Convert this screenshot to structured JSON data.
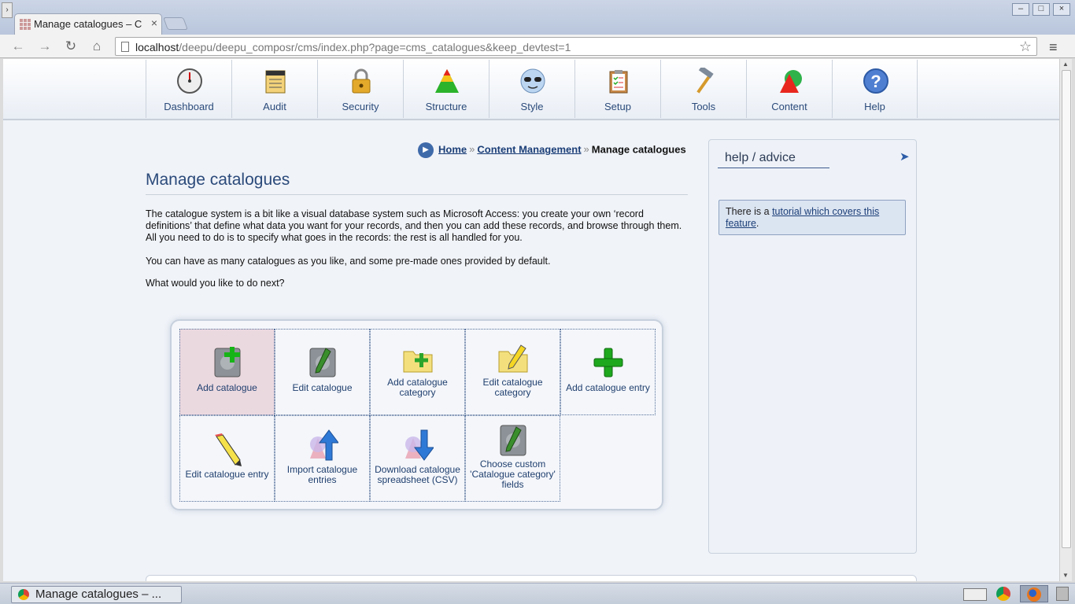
{
  "browser": {
    "tab_title": "Manage catalogues – C",
    "url_host": "localhost",
    "url_path": "/deepu/deepu_composr/cms/index.php?page=cms_catalogues&keep_devtest=1"
  },
  "admin_menu": [
    {
      "label": "Dashboard",
      "icon": "dashboard-gauge-icon"
    },
    {
      "label": "Audit",
      "icon": "audit-ledger-icon"
    },
    {
      "label": "Security",
      "icon": "padlock-icon"
    },
    {
      "label": "Structure",
      "icon": "pyramid-icon"
    },
    {
      "label": "Style",
      "icon": "sunglasses-face-icon"
    },
    {
      "label": "Setup",
      "icon": "clipboard-checklist-icon"
    },
    {
      "label": "Tools",
      "icon": "hammer-icon"
    },
    {
      "label": "Content",
      "icon": "shapes-icon"
    },
    {
      "label": "Help",
      "icon": "question-mark-icon"
    }
  ],
  "breadcrumb": {
    "home": "Home",
    "sep": "»",
    "section": "Content Management",
    "current": "Manage catalogues"
  },
  "page": {
    "title": "Manage catalogues",
    "intro": "The catalogue system is a bit like a visual database system such as Microsoft Access: you create your own ‘record definitions’ that define what data you want for your records, and then you can add these records, and browse through them. All you need to do is to specify what goes in the records: the rest is all handled for you.",
    "intro2": "You can have as many catalogues as you like, and some pre-made ones provided by default.",
    "prompt": "What would you like to do next?"
  },
  "actions": [
    {
      "label": "Add catalogue",
      "icon": "add-catalogue-icon"
    },
    {
      "label": "Edit catalogue",
      "icon": "edit-catalogue-icon"
    },
    {
      "label": "Add catalogue category",
      "icon": "add-folder-icon"
    },
    {
      "label": "Edit catalogue category",
      "icon": "edit-folder-icon"
    },
    {
      "label": "Add catalogue entry",
      "icon": "green-plus-icon"
    },
    {
      "label": "Edit catalogue entry",
      "icon": "pencil-icon"
    },
    {
      "label": "Import catalogue entries",
      "icon": "import-up-arrow-icon"
    },
    {
      "label": "Download catalogue spreadsheet (CSV)",
      "icon": "download-down-arrow-icon"
    },
    {
      "label": "Choose custom 'Catalogue category' fields",
      "icon": "custom-fields-icon"
    }
  ],
  "help": {
    "heading": "help / advice",
    "text_before": "There is a ",
    "link_text": "tutorial which covers this feature",
    "text_after": "."
  },
  "taskbar": {
    "window_label": "Manage catalogues – ..."
  }
}
